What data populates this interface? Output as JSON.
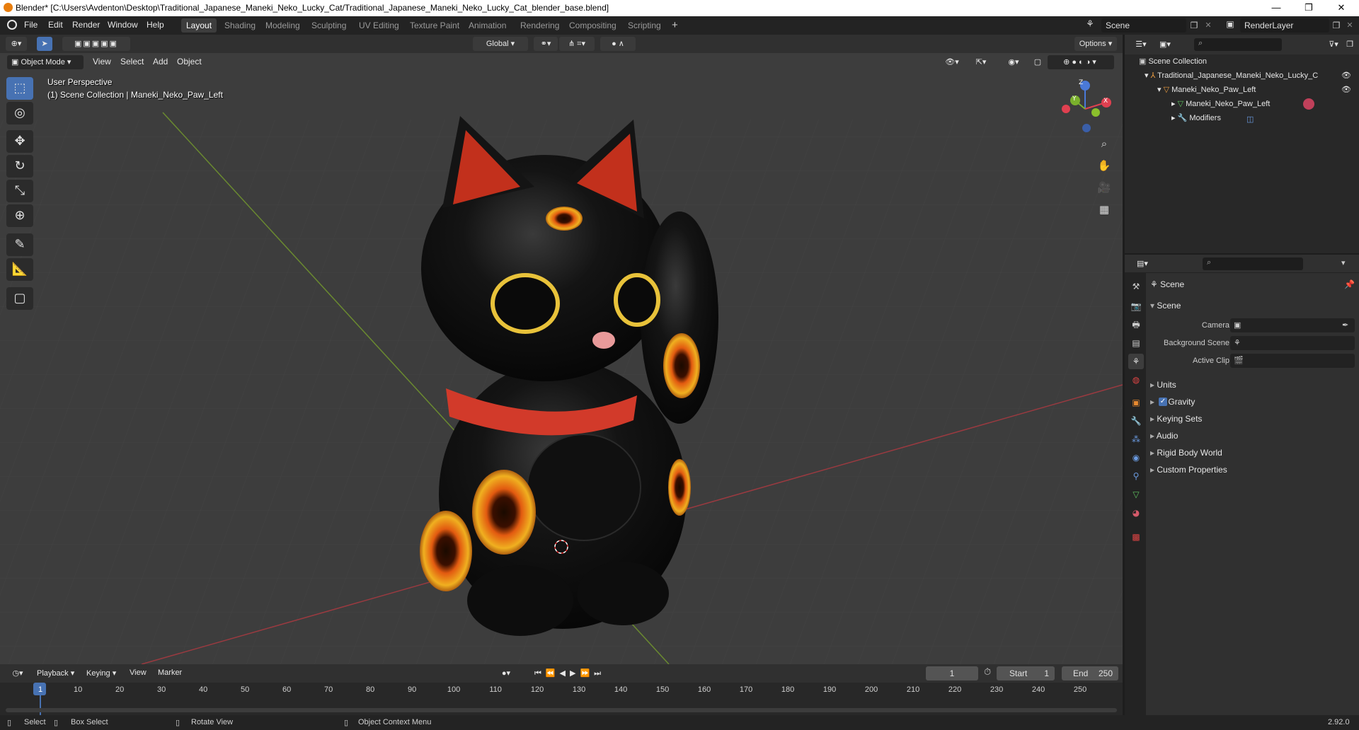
{
  "window": {
    "title": "Blender* [C:\\Users\\Avdenton\\Desktop\\Traditional_Japanese_Maneki_Neko_Lucky_Cat/Traditional_Japanese_Maneki_Neko_Lucky_Cat_blender_base.blend]",
    "minimize": "—",
    "maximize": "❐",
    "close": "✕"
  },
  "menu": [
    "File",
    "Edit",
    "Render",
    "Window",
    "Help"
  ],
  "workspaces": [
    "Layout",
    "Shading",
    "Modeling",
    "Sculpting",
    "UV Editing",
    "Texture Paint",
    "Animation",
    "Rendering",
    "Compositing",
    "Scripting"
  ],
  "active_workspace": "Layout",
  "add_workspace": "+",
  "scene_field": "Scene",
  "renderlayer_field": "RenderLayer",
  "viewport": {
    "mode": "Object Mode",
    "menus": [
      "View",
      "Select",
      "Add",
      "Object"
    ],
    "transform_orientation": "Global",
    "options": "Options",
    "overlay_title": "User Perspective",
    "overlay_subtitle": "(1) Scene Collection | Maneki_Neko_Paw_Left",
    "gizmo": {
      "z": "Z",
      "y": "Y",
      "x": "X"
    },
    "accent": "#4772b3"
  },
  "outliner": {
    "rows": [
      {
        "label": "Scene Collection"
      },
      {
        "label": "Traditional_Japanese_Maneki_Neko_Lucky_C"
      },
      {
        "label": "Maneki_Neko_Paw_Left"
      },
      {
        "label": "Maneki_Neko_Paw_Left"
      },
      {
        "label": "Modifiers"
      }
    ]
  },
  "properties": {
    "header": "Scene",
    "section": "Scene",
    "fields": [
      {
        "label": "Camera"
      },
      {
        "label": "Background Scene"
      },
      {
        "label": "Active Clip"
      }
    ],
    "panels": [
      "Units",
      "Gravity",
      "Keying Sets",
      "Audio",
      "Rigid Body World",
      "Custom Properties"
    ],
    "gravity_checked": true
  },
  "timeline": {
    "menus": [
      "Playback",
      "Keying",
      "View",
      "Marker"
    ],
    "current_frame": "1",
    "start_label": "Start",
    "start": "1",
    "end_label": "End",
    "end": "250",
    "ticks": [
      "1",
      "10",
      "20",
      "30",
      "40",
      "50",
      "60",
      "70",
      "80",
      "90",
      "100",
      "110",
      "120",
      "130",
      "140",
      "150",
      "160",
      "170",
      "180",
      "190",
      "200",
      "210",
      "220",
      "230",
      "240",
      "250"
    ]
  },
  "status": {
    "select": "Select",
    "box_select": "Box Select",
    "rotate_view": "Rotate View",
    "context_menu": "Object Context Menu",
    "version": "2.92.0"
  }
}
